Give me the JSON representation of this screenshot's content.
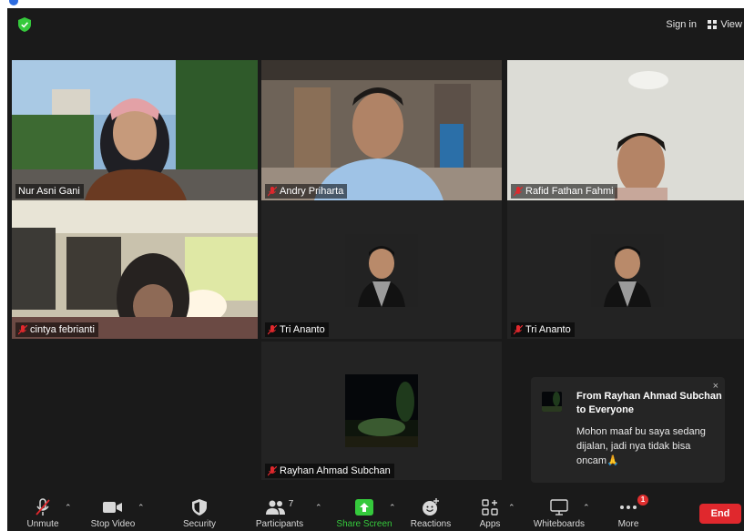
{
  "header": {
    "sign_in": "Sign in",
    "view": "View",
    "icons": [
      "shield-check-icon",
      "grid-view-icon"
    ]
  },
  "participants": [
    {
      "name": "Nur Asni Gani",
      "muted": false,
      "speaking": true,
      "video": "on"
    },
    {
      "name": "Andry Priharta",
      "muted": true,
      "video": "on"
    },
    {
      "name": "Rafid Fathan Fahmi",
      "muted": true,
      "video": "on"
    },
    {
      "name": "cintya febrianti",
      "muted": true,
      "video": "on"
    },
    {
      "name": "Tri Ananto",
      "muted": true,
      "video": "off"
    },
    {
      "name": "Tri Ananto",
      "muted": true,
      "video": "off"
    },
    {
      "name": "Rayhan Ahmad Subchan",
      "muted": true,
      "video": "off"
    }
  ],
  "chat_popup": {
    "from_line": "From Rayhan Ahmad Subchan to Everyone",
    "message": "Mohon maaf bu saya sedang dijalan, jadi nya tidak bisa oncam🙏",
    "close": "×"
  },
  "toolbar": {
    "unmute": "Unmute",
    "stop_video": "Stop Video",
    "security": "Security",
    "participants": "Participants",
    "participants_count": "7",
    "share_screen": "Share Screen",
    "reactions": "Reactions",
    "apps": "Apps",
    "whiteboards": "Whiteboards",
    "more": "More",
    "more_badge": "1",
    "end": "End"
  },
  "colors": {
    "active_speaker_border": "#c4dc52",
    "share_green": "#35c93c",
    "end_red": "#e0282d",
    "muted_red": "#e0282d"
  }
}
